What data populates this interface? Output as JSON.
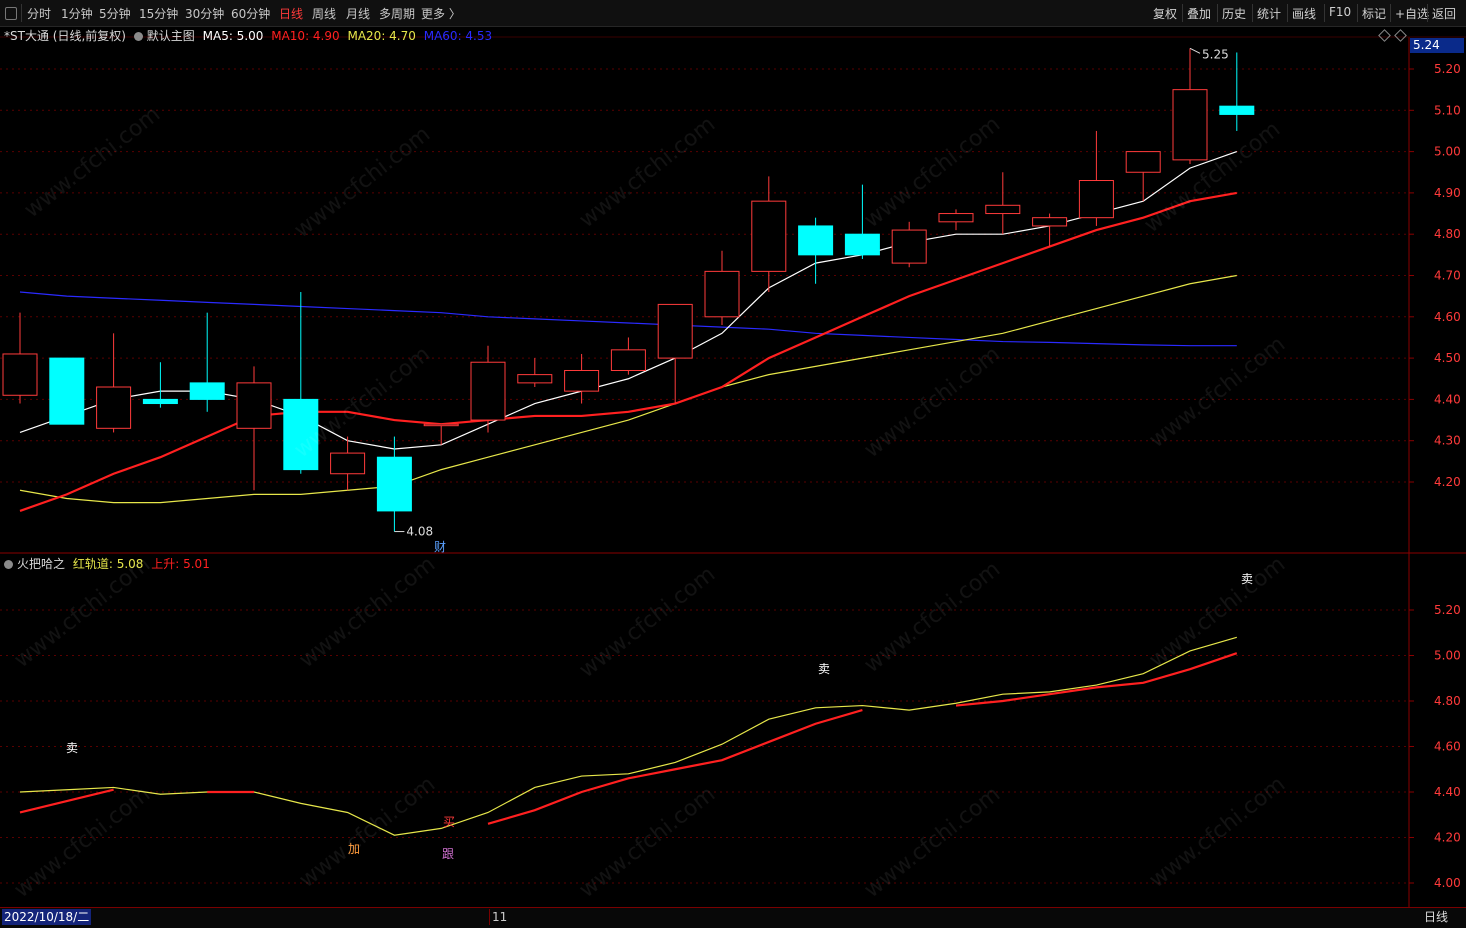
{
  "toolbar": {
    "left_items": [
      "分时",
      "1分钟",
      "5分钟",
      "15分钟",
      "30分钟",
      "60分钟",
      "日线",
      "周线",
      "月线",
      "多周期",
      "更多 〉"
    ],
    "active_index": 6,
    "right_items": [
      "复权",
      "叠加",
      "历史",
      "统计",
      "画线",
      "F10",
      "标记",
      "+自选",
      "返回"
    ]
  },
  "main_legend": {
    "title": "*ST大通 (日线,前复权)",
    "indicator": "默认主图",
    "ma5": "MA5: 5.00",
    "ma10": "MA10: 4.90",
    "ma20": "MA20: 4.70",
    "ma60": "MA60: 4.53"
  },
  "sub_legend": {
    "title": "火把哈之",
    "red_channel": "红轨道: 5.08",
    "rise": "上升: 5.01"
  },
  "current_price": "5.24",
  "annotations": {
    "high": "5.25",
    "low": "4.08",
    "finance_mark": "财",
    "sell": "卖",
    "buy": "买",
    "add": "加",
    "follow": "跟"
  },
  "bottom": {
    "date": "2022/10/18/二",
    "month_mark": "11",
    "period": "日线"
  },
  "watermark": "www.cfchi.com",
  "colors": {
    "up": "#ff3b3b",
    "down": "#00ffff",
    "ma5": "#ffffff",
    "ma10": "#ff2020",
    "ma20": "#e6e64a",
    "ma60": "#2a2aff",
    "axis_text": "#ff3a3a"
  },
  "chart_data": {
    "type": "candlestick",
    "price_axis_ticks": [
      "5.20",
      "5.10",
      "5.00",
      "4.90",
      "4.80",
      "4.70",
      "4.60",
      "4.50",
      "4.40",
      "4.30",
      "4.20"
    ],
    "sub_axis_ticks": [
      "5.20",
      "5.00",
      "4.80",
      "4.60",
      "4.40",
      "4.20",
      "4.00"
    ],
    "candles": [
      {
        "o": 4.41,
        "c": 4.51,
        "h": 4.61,
        "l": 4.39
      },
      {
        "o": 4.5,
        "c": 4.34,
        "h": 4.5,
        "l": 4.34
      },
      {
        "o": 4.33,
        "c": 4.43,
        "h": 4.56,
        "l": 4.32
      },
      {
        "o": 4.4,
        "c": 4.39,
        "h": 4.49,
        "l": 4.38
      },
      {
        "o": 4.44,
        "c": 4.4,
        "h": 4.61,
        "l": 4.37
      },
      {
        "o": 4.33,
        "c": 4.44,
        "h": 4.48,
        "l": 4.18
      },
      {
        "o": 4.4,
        "c": 4.23,
        "h": 4.66,
        "l": 4.22
      },
      {
        "o": 4.22,
        "c": 4.27,
        "h": 4.31,
        "l": 4.18
      },
      {
        "o": 4.26,
        "c": 4.13,
        "h": 4.31,
        "l": 4.08
      },
      {
        "o": 4.34,
        "c": 4.34,
        "h": 4.34,
        "l": 4.29
      },
      {
        "o": 4.35,
        "c": 4.49,
        "h": 4.53,
        "l": 4.32
      },
      {
        "o": 4.44,
        "c": 4.46,
        "h": 4.5,
        "l": 4.43
      },
      {
        "o": 4.42,
        "c": 4.47,
        "h": 4.51,
        "l": 4.39
      },
      {
        "o": 4.47,
        "c": 4.52,
        "h": 4.55,
        "l": 4.46
      },
      {
        "o": 4.5,
        "c": 4.63,
        "h": 4.63,
        "l": 4.39
      },
      {
        "o": 4.6,
        "c": 4.71,
        "h": 4.76,
        "l": 4.58
      },
      {
        "o": 4.71,
        "c": 4.88,
        "h": 4.94,
        "l": 4.66
      },
      {
        "o": 4.82,
        "c": 4.75,
        "h": 4.84,
        "l": 4.68
      },
      {
        "o": 4.8,
        "c": 4.75,
        "h": 4.92,
        "l": 4.74
      },
      {
        "o": 4.73,
        "c": 4.81,
        "h": 4.83,
        "l": 4.72
      },
      {
        "o": 4.83,
        "c": 4.85,
        "h": 4.86,
        "l": 4.81
      },
      {
        "o": 4.85,
        "c": 4.87,
        "h": 4.95,
        "l": 4.8
      },
      {
        "o": 4.82,
        "c": 4.84,
        "h": 4.85,
        "l": 4.77
      },
      {
        "o": 4.84,
        "c": 4.93,
        "h": 5.05,
        "l": 4.82
      },
      {
        "o": 4.95,
        "c": 5.0,
        "h": 5.0,
        "l": 4.88
      },
      {
        "o": 4.98,
        "c": 5.15,
        "h": 5.25,
        "l": 4.97
      },
      {
        "o": 5.11,
        "c": 5.09,
        "h": 5.24,
        "l": 5.05
      }
    ],
    "ma5": [
      4.32,
      4.36,
      4.4,
      4.42,
      4.42,
      4.4,
      4.36,
      4.3,
      4.28,
      4.29,
      4.34,
      4.39,
      4.42,
      4.45,
      4.5,
      4.56,
      4.67,
      4.73,
      4.75,
      4.78,
      4.8,
      4.8,
      4.82,
      4.85,
      4.88,
      4.96,
      5.0
    ],
    "ma10": [
      4.13,
      4.17,
      4.22,
      4.26,
      4.31,
      4.36,
      4.37,
      4.37,
      4.35,
      4.34,
      4.35,
      4.36,
      4.36,
      4.37,
      4.39,
      4.43,
      4.5,
      4.55,
      4.6,
      4.65,
      4.69,
      4.73,
      4.77,
      4.81,
      4.84,
      4.88,
      4.9
    ],
    "ma20": [
      4.18,
      4.16,
      4.15,
      4.15,
      4.16,
      4.17,
      4.17,
      4.18,
      4.19,
      4.23,
      4.26,
      4.29,
      4.32,
      4.35,
      4.39,
      4.43,
      4.46,
      4.48,
      4.5,
      4.52,
      4.54,
      4.56,
      4.59,
      4.62,
      4.65,
      4.68,
      4.7
    ],
    "ma60": [
      4.66,
      4.65,
      4.645,
      4.64,
      4.635,
      4.63,
      4.625,
      4.62,
      4.615,
      4.61,
      4.6,
      4.595,
      4.59,
      4.585,
      4.58,
      4.575,
      4.57,
      4.56,
      4.555,
      4.55,
      4.545,
      4.54,
      4.538,
      4.535,
      4.532,
      4.53,
      4.53
    ],
    "red_channel": [
      4.4,
      4.41,
      4.42,
      4.39,
      4.4,
      4.4,
      4.35,
      4.31,
      4.21,
      4.24,
      4.31,
      4.42,
      4.47,
      4.48,
      4.53,
      4.61,
      4.72,
      4.77,
      4.78,
      4.76,
      4.79,
      4.83,
      4.84,
      4.87,
      4.92,
      5.02,
      5.08
    ],
    "rise": [
      4.31,
      4.36,
      4.41,
      null,
      4.4,
      4.4,
      null,
      null,
      null,
      null,
      4.26,
      4.32,
      4.4,
      4.46,
      4.5,
      4.54,
      4.62,
      4.7,
      4.76,
      null,
      4.78,
      4.8,
      4.83,
      4.86,
      4.88,
      4.94,
      5.01
    ]
  }
}
